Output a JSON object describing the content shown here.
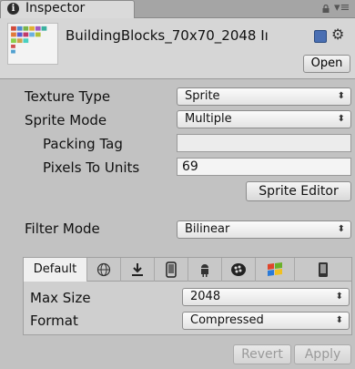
{
  "window": {
    "tab_title": "Inspector"
  },
  "header": {
    "asset_name": "BuildingBlocks_70x70_2048 Iı",
    "open_label": "Open"
  },
  "fields": {
    "texture_type_label": "Texture Type",
    "texture_type_value": "Sprite",
    "sprite_mode_label": "Sprite Mode",
    "sprite_mode_value": "Multiple",
    "packing_tag_label": "Packing Tag",
    "packing_tag_value": "",
    "pixels_to_units_label": "Pixels To Units",
    "pixels_to_units_value": "69",
    "sprite_editor_label": "Sprite Editor",
    "filter_mode_label": "Filter Mode",
    "filter_mode_value": "Bilinear"
  },
  "platform": {
    "tabs": [
      {
        "label": "Default",
        "icon": "default",
        "active": true
      },
      {
        "label": "",
        "icon": "globe-icon"
      },
      {
        "label": "",
        "icon": "download-icon"
      },
      {
        "label": "",
        "icon": "phone-icon"
      },
      {
        "label": "",
        "icon": "android-icon"
      },
      {
        "label": "",
        "icon": "blackberry-icon"
      },
      {
        "label": "",
        "icon": "windows-icon"
      },
      {
        "label": "",
        "icon": "device-icon"
      }
    ],
    "max_size_label": "Max Size",
    "max_size_value": "2048",
    "format_label": "Format",
    "format_value": "Compressed"
  },
  "actions": {
    "revert_label": "Revert",
    "apply_label": "Apply"
  },
  "colors": {
    "background": "#c2c2c2",
    "tabbar": "#a5a5a5",
    "header": "#d6d6d6"
  }
}
